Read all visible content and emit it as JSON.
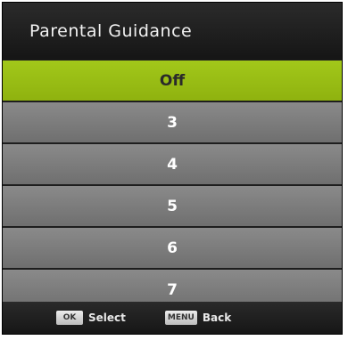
{
  "header": {
    "title": "Parental Guidance"
  },
  "options": [
    {
      "label": "Off",
      "selected": true
    },
    {
      "label": "3",
      "selected": false
    },
    {
      "label": "4",
      "selected": false
    },
    {
      "label": "5",
      "selected": false
    },
    {
      "label": "6",
      "selected": false
    },
    {
      "label": "7",
      "selected": false
    }
  ],
  "footer": {
    "select_key": "OK",
    "select_label": "Select",
    "back_key": "MENU",
    "back_label": "Back"
  },
  "colors": {
    "highlight": "#9cc217",
    "option_bg": "#7d7d7d",
    "panel_bg": "#1e1e1e"
  }
}
